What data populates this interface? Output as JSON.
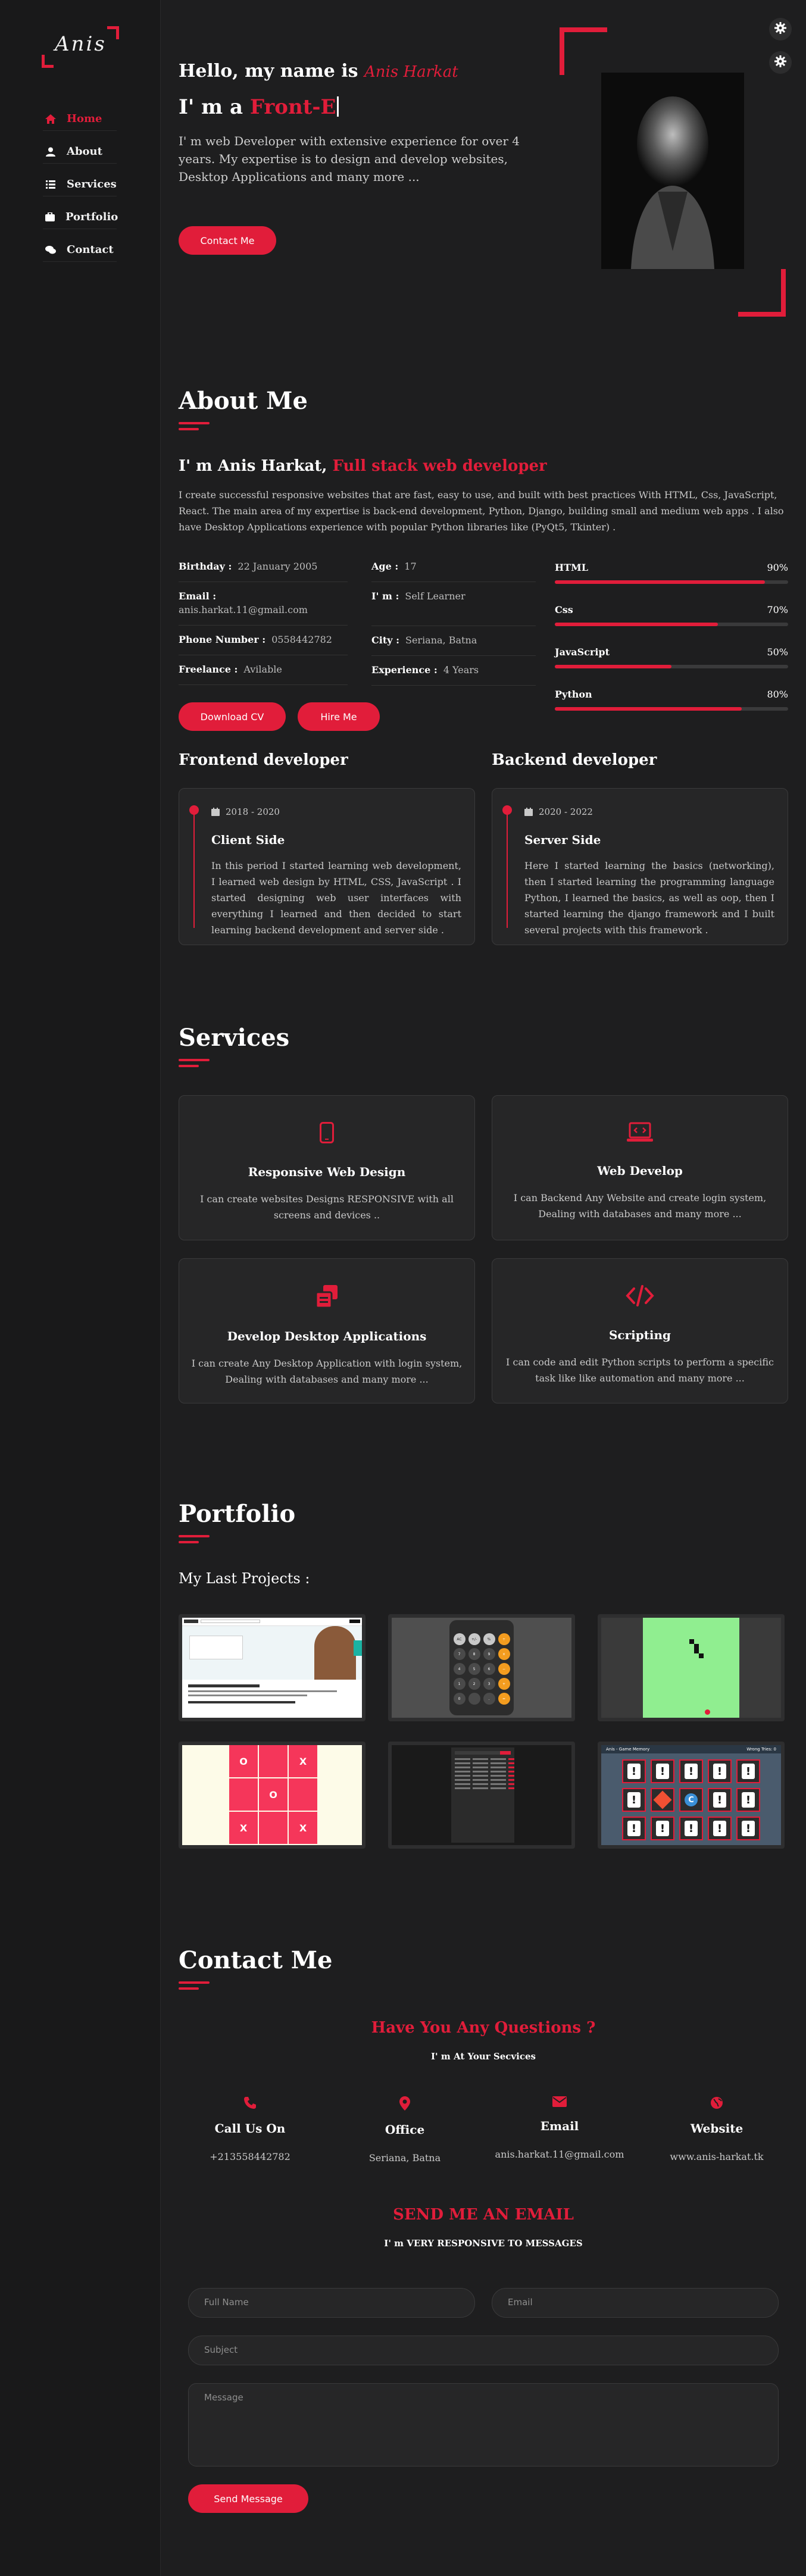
{
  "sidebar": {
    "logo": "Anis",
    "items": [
      {
        "label": "Home",
        "icon": "home-icon"
      },
      {
        "label": "About",
        "icon": "user-icon"
      },
      {
        "label": "Services",
        "icon": "list-icon"
      },
      {
        "label": "Portfolio",
        "icon": "briefcase-icon"
      },
      {
        "label": "Contact",
        "icon": "comments-icon"
      }
    ]
  },
  "hero": {
    "greeting": "Hello, my name is ",
    "name_script": "Anis Harkat",
    "role_prefix": "I' m a ",
    "role_typed": "Front-E",
    "description": "I' m web Developer with extensive experience for over 4 years. My expertise is to design and develop websites, Desktop Applications and many more ...",
    "cta": "Contact Me"
  },
  "about": {
    "title": "About Me",
    "headline_prefix": "I' m Anis Harkat, ",
    "headline_role": "Full stack web developer",
    "paragraph": "I create successful responsive websites that are fast, easy to use, and built with best practices With HTML, Css, JavaScript, React. The main area of my expertise is back-end development, Python, Django, building small and medium web apps . I also have Desktop Applications experience with popular Python libraries like (PyQt5, Tkinter) .",
    "info_left": [
      {
        "key": "Birthday :",
        "value": "22 January 2005"
      },
      {
        "key": "Email :",
        "value": "anis.harkat.11@gmail.com"
      },
      {
        "key": "Phone Number :",
        "value": "0558442782"
      },
      {
        "key": "Freelance :",
        "value": "Avilable"
      }
    ],
    "info_right": [
      {
        "key": "Age :",
        "value": "17"
      },
      {
        "key": "I' m :",
        "value": "Self Learner"
      },
      {
        "key": "City :",
        "value": "Seriana, Batna"
      },
      {
        "key": "Experience :",
        "value": "4 Years"
      }
    ],
    "skills": [
      {
        "name": "HTML",
        "percent_label": "90%",
        "value": 90
      },
      {
        "name": "Css",
        "percent_label": "70%",
        "value": 70
      },
      {
        "name": "JavaScript",
        "percent_label": "50%",
        "value": 50
      },
      {
        "name": "Python",
        "percent_label": "80%",
        "value": 80
      }
    ],
    "download_cv": "Download CV",
    "hire_me": "Hire Me"
  },
  "timeline": [
    {
      "heading": "Frontend developer",
      "date": "2018 - 2020",
      "title": "Client Side",
      "text": "In this period I started learning web development, I learned web design by HTML, CSS, JavaScript . I started designing web user interfaces with everything I learned and then decided to start learning backend development and server side ."
    },
    {
      "heading": "Backend developer",
      "date": "2020 - 2022",
      "title": "Server Side",
      "text": "Here I started learning the basics (networking), then I started learning the programming language Python, I learned the basics, as well as oop, then I started learning the django framework and I built several projects with this framework ."
    }
  ],
  "services": {
    "title": "Services",
    "items": [
      {
        "title": "Responsive Web Design",
        "text": "I can create websites Designs RESPONSIVE with all screens and devices ..",
        "icon": "mobile-icon"
      },
      {
        "title": "Web Develop",
        "text": "I can Backend Any Website and create login system, Dealing with databases and many more ...",
        "icon": "laptop-code-icon"
      },
      {
        "title": "Develop Desktop Applications",
        "text": "I can create Any Desktop Application with login system, Dealing with databases and many more ...",
        "icon": "desktop-app-icon"
      },
      {
        "title": "Scripting",
        "text": "I can code and edit Python scripts to perform a specific task like like automation and many more ...",
        "icon": "code-icon"
      }
    ]
  },
  "portfolio": {
    "title": "Portfolio",
    "subtitle": "My Last Projects :",
    "projects": [
      {
        "name": "udemy-clone"
      },
      {
        "name": "calculator"
      },
      {
        "name": "snake-game"
      },
      {
        "name": "tic-tac-toe"
      },
      {
        "name": "dark-table-app"
      },
      {
        "name": "memory-game"
      }
    ],
    "tictactoe": [
      "O",
      "",
      "X",
      "",
      "O",
      "",
      "X",
      "",
      "X"
    ],
    "calc_keys": [
      "AC",
      "+/-",
      "%",
      "÷",
      "7",
      "8",
      "9",
      "×",
      "4",
      "5",
      "6",
      "−",
      "1",
      "2",
      "3",
      "+",
      "0",
      "",
      ".",
      "="
    ],
    "memory_title": "Anis - Game Memory",
    "memory_tries": "Wrong Tries: 0",
    "memory_symbol": "!"
  },
  "contact": {
    "title": "Contact Me",
    "questions": "Have You Any Questions ?",
    "service": "I' m At Your Secvices",
    "cards": [
      {
        "title": "Call Us On",
        "value": "+213558442782",
        "icon": "phone-icon"
      },
      {
        "title": "Office",
        "value": "Seriana, Batna",
        "icon": "map-marker-icon"
      },
      {
        "title": "Email",
        "value": "anis.harkat.11@gmail.com",
        "icon": "envelope-icon"
      },
      {
        "title": "Website",
        "value": "www.anis-harkat.tk",
        "icon": "globe-icon"
      }
    ],
    "send_title": "SEND ME AN EMAIL",
    "responsive": "I' m VERY RESPONSIVE TO MESSAGES",
    "form": {
      "name_placeholder": "Full Name",
      "email_placeholder": "Email",
      "subject_placeholder": "Subject",
      "message_placeholder": "Message",
      "submit": "Send Message"
    }
  },
  "colors": {
    "accent": "#e11d3a",
    "background": "#1e1e1f",
    "sidebar": "#19191a",
    "card": "#262627"
  }
}
